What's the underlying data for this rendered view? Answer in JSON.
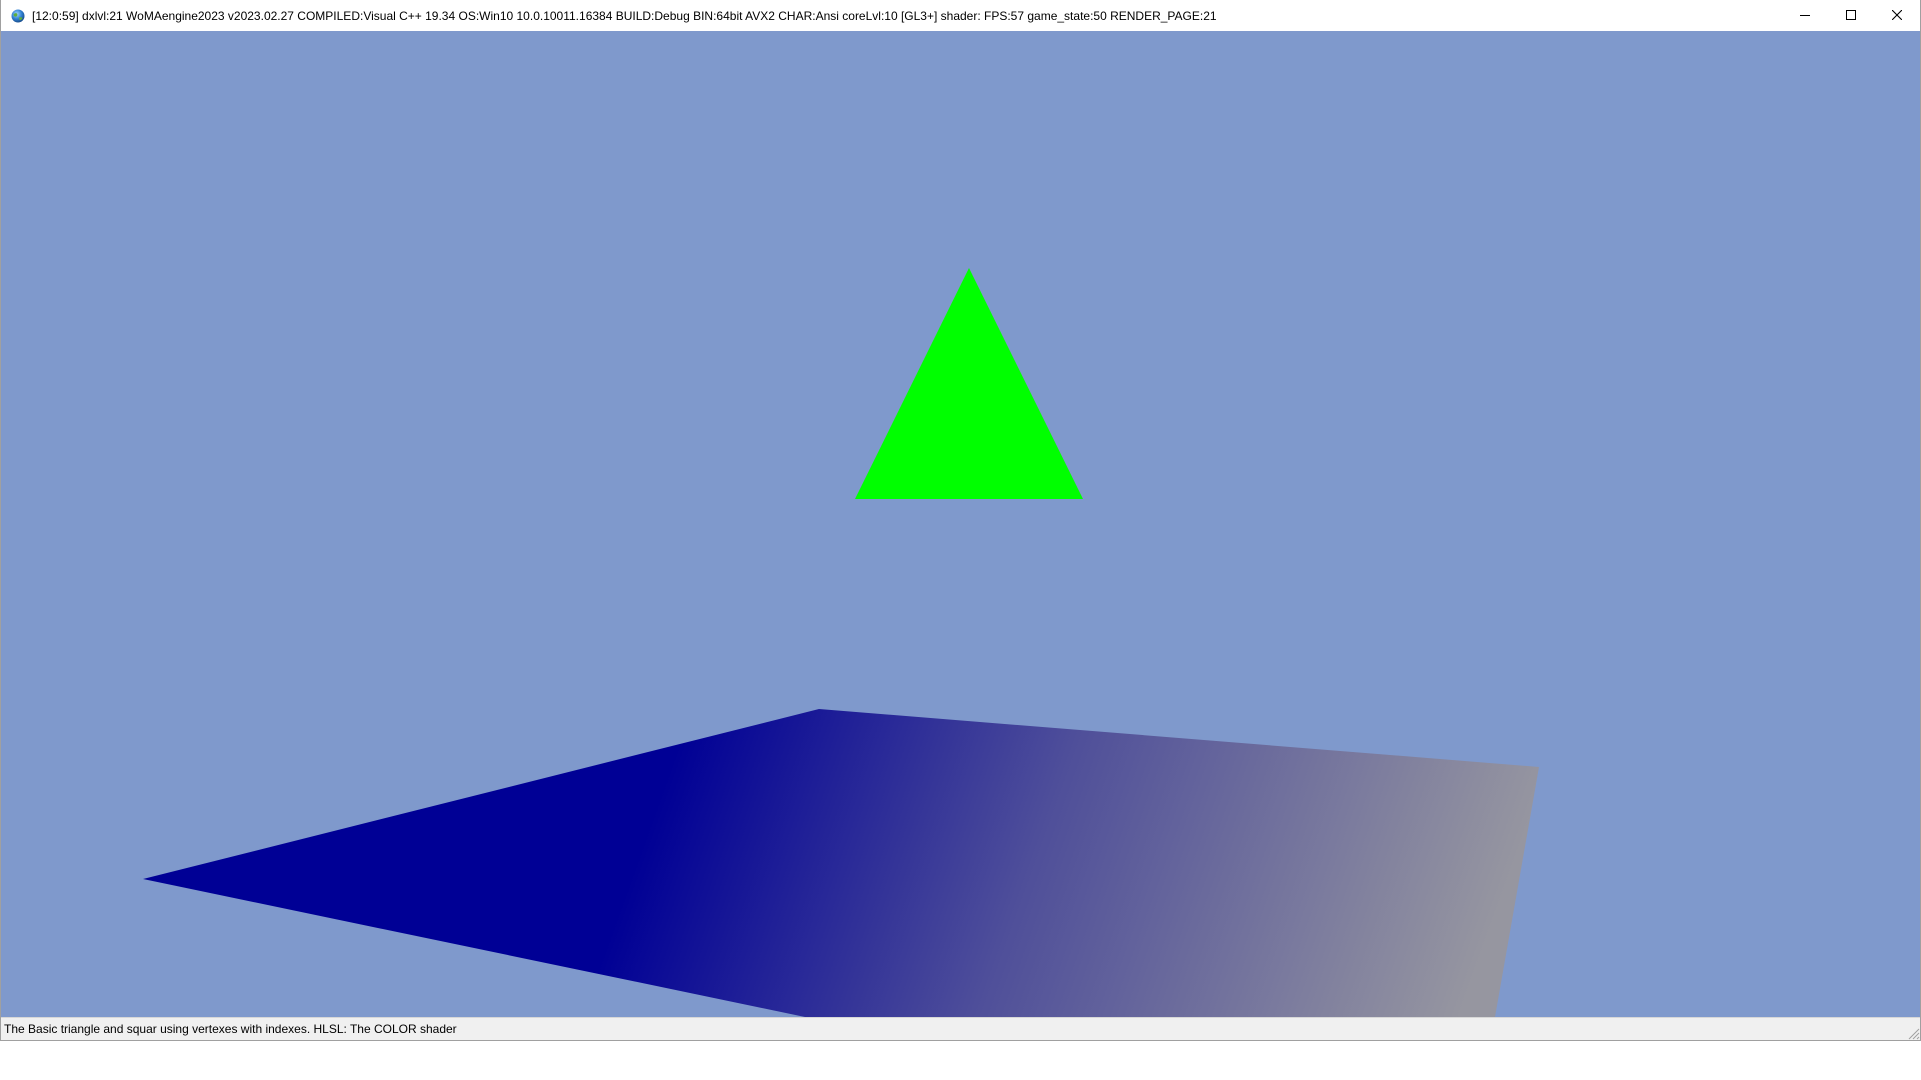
{
  "window": {
    "title": "[12:0:59] dxlvl:21 WoMAengine2023 v2023.02.27 COMPILED:Visual C++ 19.34 OS:Win10 10.0.10011.16384 BUILD:Debug BIN:64bit AVX2 CHAR:Ansi coreLvl:10 [GL3+] shader: FPS:57 game_state:50 RENDER_PAGE:21",
    "icons": {
      "app": "globe-icon",
      "minimize": "minimize-icon",
      "maximize": "maximize-icon",
      "close": "close-icon",
      "grip": "size-grip-icon"
    }
  },
  "scene": {
    "background_color": "#7f99cc",
    "triangle_color": "#00ff00",
    "square_colors": {
      "dark_blue": "#000095",
      "gray": "#9696a0"
    }
  },
  "statusbar": {
    "text": "The Basic triangle and squar using vertexes with indexes. HLSL: The COLOR shader"
  }
}
